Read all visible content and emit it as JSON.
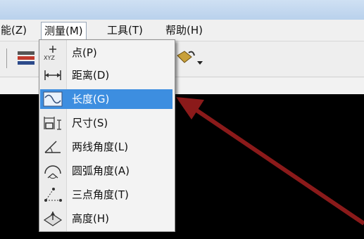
{
  "menubar": {
    "items": [
      {
        "label": "能(Z)"
      },
      {
        "label": "测量(M)"
      },
      {
        "label": "工具(T)"
      },
      {
        "label": "帮助(H)"
      }
    ]
  },
  "dropdown": {
    "items": [
      {
        "label": "点(P)",
        "icon": "point-xyz-icon"
      },
      {
        "label": "距离(D)",
        "icon": "distance-icon"
      },
      {
        "label": "长度(G)",
        "icon": "length-curve-icon",
        "selected": true
      },
      {
        "label": "尺寸(S)",
        "icon": "dimension-icon"
      },
      {
        "label": "两线角度(L)",
        "icon": "two-line-angle-icon"
      },
      {
        "label": "圆弧角度(A)",
        "icon": "arc-angle-icon"
      },
      {
        "label": "三点角度(T)",
        "icon": "three-point-angle-icon"
      },
      {
        "label": "高度(H)",
        "icon": "height-icon"
      }
    ],
    "xyz_caption": "XYZ"
  },
  "colors": {
    "highlight": "#3d8ee0",
    "arrow": "#8b1a1a",
    "canvas": "#000000"
  }
}
